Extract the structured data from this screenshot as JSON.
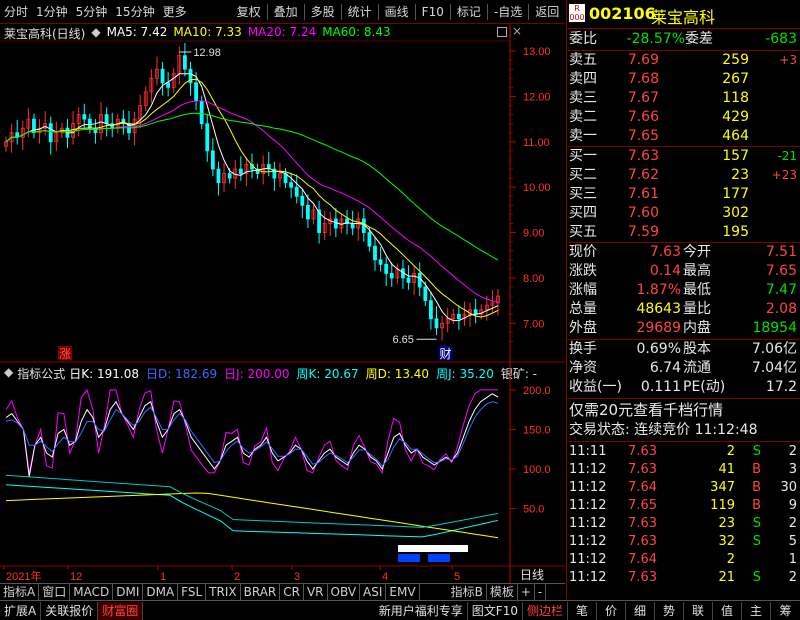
{
  "toolbar": {
    "items_left": [
      "分时",
      "1分钟",
      "5分钟",
      "15分钟",
      "更多"
    ],
    "items_right": [
      "复权",
      "叠加",
      "多股",
      "统计",
      "画线",
      "F10",
      "标记",
      "-自选",
      "返回"
    ]
  },
  "chart_title": {
    "name": "莱宝高科(日线)",
    "ma5": "MA5: 7.42",
    "ma10": "MA10: 7.33",
    "ma20": "MA20: 7.24",
    "ma60": "MA60: 8.43"
  },
  "colors": {
    "ma5": "#ffffff",
    "ma10": "#ffff00",
    "ma20": "#ff00ff",
    "ma60": "#00ff00",
    "up": "#ff3030",
    "down": "#00ffff",
    "axis": "#ff3030"
  },
  "chart_data": [
    {
      "type": "candlestick",
      "ylim": [
        6.5,
        13.2
      ],
      "yticks": [
        13.0,
        12.0,
        11.0,
        10.0,
        9.0,
        8.0,
        7.0
      ],
      "annotations": [
        {
          "text": "12.98",
          "value": 12.98
        },
        {
          "text": "6.65",
          "value": 6.65
        },
        {
          "text": "涨"
        },
        {
          "text": "财"
        }
      ],
      "series": [
        {
          "name": "MA5",
          "value": 7.42
        },
        {
          "name": "MA10",
          "value": 7.33
        },
        {
          "name": "MA20",
          "value": 7.24
        },
        {
          "name": "MA60",
          "value": 8.43
        }
      ],
      "x_labels": [
        "2021年",
        "12",
        "1",
        "2",
        "3",
        "4",
        "5"
      ],
      "close": [
        11.0,
        11.2,
        11.1,
        11.3,
        11.5,
        11.2,
        11.3,
        11.4,
        11.0,
        11.2,
        11.3,
        11.1,
        11.4,
        11.6,
        11.5,
        11.3,
        11.2,
        11.6,
        11.4,
        11.3,
        11.5,
        11.4,
        11.2,
        11.5,
        11.8,
        12.1,
        12.4,
        12.6,
        12.3,
        12.2,
        12.5,
        12.9,
        12.6,
        12.3,
        11.9,
        11.4,
        10.8,
        10.4,
        10.1,
        10.3,
        10.2,
        10.4,
        10.3,
        10.5,
        10.4,
        10.3,
        10.5,
        10.4,
        10.2,
        10.3,
        10.1,
        10.0,
        9.8,
        9.6,
        9.3,
        9.5,
        9.0,
        9.2,
        9.3,
        9.1,
        9.3,
        9.2,
        9.1,
        9.3,
        9.0,
        8.7,
        8.4,
        8.3,
        8.1,
        8.0,
        8.2,
        8.0,
        7.9,
        8.1,
        7.8,
        7.5,
        7.1,
        6.9,
        7.0,
        7.1,
        7.2,
        7.1,
        7.2,
        7.3,
        7.2,
        7.3,
        7.4,
        7.45,
        7.6
      ]
    },
    {
      "type": "line",
      "ylim": [
        0,
        215
      ],
      "yticks": [
        200.0,
        150.0,
        100.0,
        50.0
      ],
      "series": [
        {
          "name": "日K",
          "value": 191.08
        },
        {
          "name": "日D",
          "value": 182.69
        },
        {
          "name": "日J",
          "value": 200.0
        },
        {
          "name": "周K",
          "value": 20.67
        },
        {
          "name": "周D",
          "value": 13.4
        },
        {
          "name": "周J",
          "value": 35.2
        }
      ],
      "k": [
        165,
        170,
        160,
        150,
        90,
        130,
        140,
        120,
        115,
        145,
        150,
        130,
        135,
        160,
        175,
        165,
        140,
        150,
        175,
        185,
        170,
        160,
        150,
        165,
        180,
        185,
        160,
        140,
        150,
        170,
        175,
        160,
        140,
        130,
        120,
        110,
        100,
        110,
        130,
        135,
        140,
        120,
        115,
        125,
        130,
        140,
        120,
        110,
        115,
        120,
        130,
        125,
        110,
        100,
        110,
        120,
        125,
        115,
        110,
        105,
        120,
        130,
        125,
        115,
        110,
        100,
        120,
        140,
        145,
        130,
        120,
        125,
        115,
        110,
        105,
        110,
        115,
        110,
        120,
        140,
        160,
        175,
        185,
        190,
        195,
        191
      ],
      "d": [
        160,
        162,
        158,
        150,
        130,
        130,
        135,
        128,
        122,
        132,
        140,
        135,
        134,
        145,
        160,
        160,
        150,
        148,
        162,
        175,
        170,
        162,
        155,
        160,
        172,
        178,
        165,
        150,
        150,
        162,
        170,
        162,
        148,
        138,
        128,
        118,
        108,
        110,
        122,
        130,
        135,
        126,
        120,
        123,
        128,
        134,
        126,
        116,
        116,
        119,
        125,
        125,
        116,
        106,
        108,
        115,
        120,
        117,
        113,
        108,
        115,
        124,
        124,
        118,
        112,
        104,
        112,
        128,
        138,
        133,
        125,
        125,
        119,
        113,
        108,
        109,
        113,
        111,
        116,
        132,
        150,
        165,
        175,
        182,
        185,
        183
      ]
    }
  ],
  "bottom_tabs": [
    "指标A",
    "窗口",
    "MACD",
    "DMI",
    "DMA",
    "FSL",
    "TRIX",
    "BRAR",
    "CR",
    "VR",
    "OBV",
    "ASI",
    "EMV",
    "指标B",
    "模板",
    "+",
    "-",
    "日线"
  ],
  "status_left": [
    "扩展A",
    "关联报价",
    "财富圈"
  ],
  "status_right": [
    "新用户福利专享",
    "图文F10",
    "侧边栏",
    "笔",
    "价",
    "细",
    "势",
    "联",
    "值",
    "主",
    "筹"
  ],
  "quote": {
    "code": "002106",
    "name": "莱宝高科",
    "webi_label": "委比",
    "webi": "-28.57%",
    "weicha_label": "委差",
    "weicha": "-683",
    "asks": [
      {
        "label": "卖五",
        "price": "7.69",
        "vol": "259",
        "chg": "+3"
      },
      {
        "label": "卖四",
        "price": "7.68",
        "vol": "267",
        "chg": ""
      },
      {
        "label": "卖三",
        "price": "7.67",
        "vol": "118",
        "chg": ""
      },
      {
        "label": "卖二",
        "price": "7.66",
        "vol": "429",
        "chg": ""
      },
      {
        "label": "卖一",
        "price": "7.65",
        "vol": "464",
        "chg": ""
      }
    ],
    "bids": [
      {
        "label": "买一",
        "price": "7.63",
        "vol": "157",
        "chg": "-21"
      },
      {
        "label": "买二",
        "price": "7.62",
        "vol": "23",
        "chg": "+23"
      },
      {
        "label": "买三",
        "price": "7.61",
        "vol": "177",
        "chg": ""
      },
      {
        "label": "买四",
        "price": "7.60",
        "vol": "302",
        "chg": ""
      },
      {
        "label": "买五",
        "price": "7.59",
        "vol": "195",
        "chg": ""
      }
    ],
    "stats": [
      {
        "l1": "现价",
        "v1": "7.63",
        "l2": "今开",
        "v2": "7.51"
      },
      {
        "l1": "涨跌",
        "v1": "0.14",
        "l2": "最高",
        "v2": "7.65"
      },
      {
        "l1": "涨幅",
        "v1": "1.87%",
        "l2": "最低",
        "v2": "7.47"
      },
      {
        "l1": "总量",
        "v1": "48643",
        "l2": "量比",
        "v2": "2.08"
      },
      {
        "l1": "外盘",
        "v1": "29689",
        "l2": "内盘",
        "v2": "18954"
      }
    ],
    "fin": [
      {
        "l1": "换手",
        "v1": "0.69%",
        "l2": "股本",
        "v2": "7.06亿"
      },
      {
        "l1": "净资",
        "v1": "6.74",
        "l2": "流通",
        "v2": "7.04亿"
      },
      {
        "l1": "收益(一)",
        "v1": "0.111",
        "l2": "PE(动)",
        "v2": "17.2"
      }
    ],
    "promo": "仅需20元查看千档行情",
    "trade_status": "交易状态: 连续竞价 11:12:48",
    "trades": [
      {
        "t": "11:11",
        "p": "7.63",
        "v": "2",
        "d": "S",
        "n": "2"
      },
      {
        "t": "11:12",
        "p": "7.63",
        "v": "41",
        "d": "B",
        "n": "3"
      },
      {
        "t": "11:12",
        "p": "7.64",
        "v": "347",
        "d": "B",
        "n": "30"
      },
      {
        "t": "11:12",
        "p": "7.65",
        "v": "119",
        "d": "B",
        "n": "9"
      },
      {
        "t": "11:12",
        "p": "7.63",
        "v": "23",
        "d": "S",
        "n": "2"
      },
      {
        "t": "11:12",
        "p": "7.63",
        "v": "32",
        "d": "S",
        "n": "5"
      },
      {
        "t": "11:12",
        "p": "7.64",
        "v": "2",
        "d": "",
        "n": "1"
      },
      {
        "t": "11:12",
        "p": "7.63",
        "v": "21",
        "d": "S",
        "n": "2"
      }
    ]
  }
}
